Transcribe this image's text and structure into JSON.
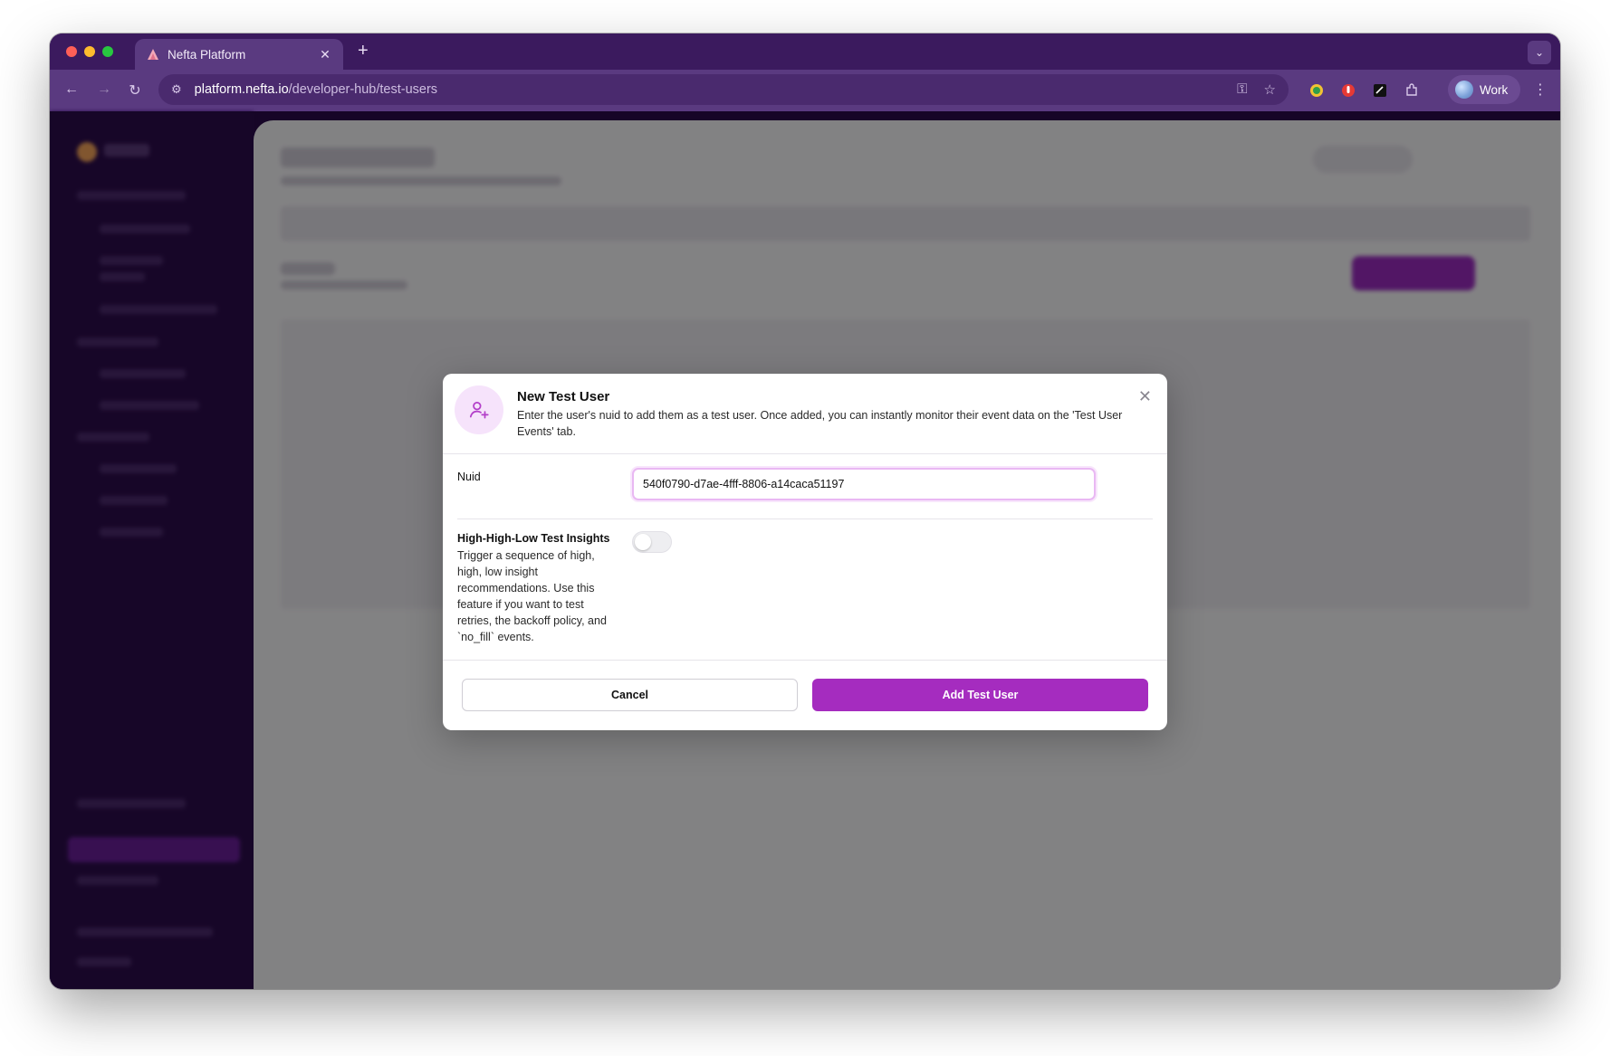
{
  "browser": {
    "tab_title": "Nefta Platform",
    "url_host": "platform.nefta.io",
    "url_path": "/developer-hub/test-users",
    "profile_name": "Work"
  },
  "icons": {
    "favicon": "nefta-logo-icon",
    "back": "arrow-left-icon",
    "forward": "arrow-right-icon",
    "reload": "reload-icon",
    "site_settings": "tune-icon",
    "password": "key-icon",
    "bookmark": "star-icon",
    "modal": "user-plus-icon",
    "close": "close-icon"
  },
  "modal": {
    "title": "New Test User",
    "description": "Enter the user's nuid to add them as a test user. Once added, you can instantly monitor their event data on the 'Test User Events' tab.",
    "nuid_label": "Nuid",
    "nuid_value": "540f0790-d7ae-4fff-8806-a14caca51197",
    "hhl_title": "High-High-Low Test Insights",
    "hhl_description": "Trigger a sequence of high, high, low insight recommendations. Use this feature if you want to test retries, the backoff policy, and `no_fill` events.",
    "hhl_enabled": false,
    "cancel_label": "Cancel",
    "submit_label": "Add Test User"
  },
  "colors": {
    "accent": "#a52cbf",
    "browser_frame": "#5a3a80",
    "sidebar": "#2d0d4d"
  }
}
